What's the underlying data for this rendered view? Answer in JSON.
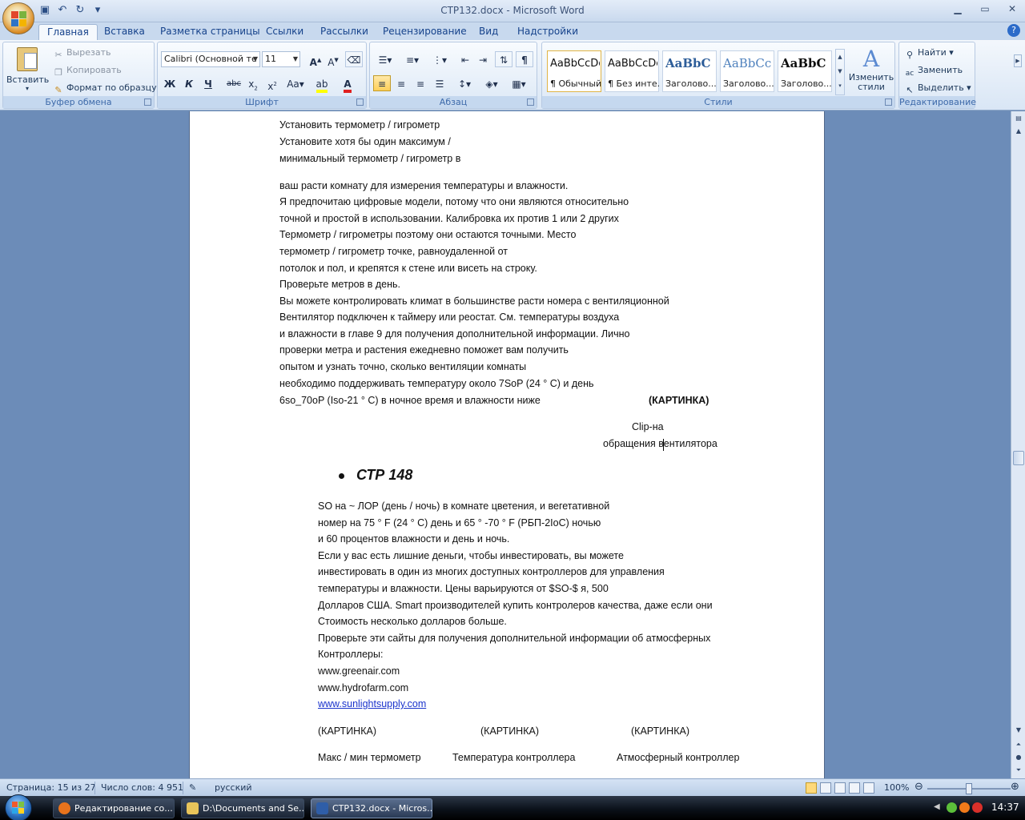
{
  "window": {
    "title": "СТР132.docx - Microsoft Word"
  },
  "tabs": [
    "Главная",
    "Вставка",
    "Разметка страницы",
    "Ссылки",
    "Рассылки",
    "Рецензирование",
    "Вид",
    "Надстройки"
  ],
  "ribbon": {
    "clipboard": {
      "label": "Буфер обмена",
      "paste": "Вставить",
      "cut": "Вырезать",
      "copy": "Копировать",
      "format_painter": "Формат по образцу"
    },
    "font": {
      "label": "Шрифт",
      "font_name": "Calibri (Основной те",
      "font_size": "11"
    },
    "paragraph": {
      "label": "Абзац"
    },
    "styles": {
      "label": "Стили",
      "items": [
        {
          "sample": "AaBbCcDc",
          "name": "¶ Обычный"
        },
        {
          "sample": "AaBbCcDc",
          "name": "¶ Без инте..."
        },
        {
          "sample": "AaBbC",
          "name": "Заголово..."
        },
        {
          "sample": "AaBbCc",
          "name": "Заголово..."
        },
        {
          "sample": "AaBbC",
          "name": "Заголово..."
        }
      ],
      "change_styles": "Изменить стили"
    },
    "editing": {
      "label": "Редактирование",
      "find": "Найти",
      "replace": "Заменить",
      "select": "Выделить"
    }
  },
  "document": {
    "lines_a": [
      "Установить термометр / гигрометр",
      "Установите хотя бы один максимум /",
      "минимальный термометр / гигрометр в"
    ],
    "lines_b": [
      "ваш расти комнату для измерения температуры и влажности.",
      "Я предпочитаю цифровые модели, потому что они являются относительно",
      "точной и простой в  использовании. Калибровка их против 1  или 2 других",
      "Термометр / гигрометры поэтому они остаются точными. Место",
      "термометр / гигрометр точке, равноудаленной от",
      "потолок и пол, и крепятся к стене или висеть на строку.",
      "Проверьте метров в день.",
      "Вы можете контролировать климат в большинстве расти номера с вентиляционной",
      "Вентилятор подключен к таймеру или реостат. См. температуры воздуха",
      "и влажности в главе 9  для получения дополнительной информации. Лично",
      "проверки метра и растения ежедневно поможет вам получить",
      "опытом и узнать точно, сколько вентиляции комнаты",
      "необходимо поддерживать температуру около 7SoP (24 ° C) и день",
      "6so_70oP (Iso-21 ° C) в ночное время и влажности ниже"
    ],
    "picture_label": "(КАРТИНКА)",
    "caption_1": "Clip-на",
    "caption_2": "обращения вентилятора",
    "heading": "СТР 148",
    "lines_c": [
      "SO на ~ ЛОР (день / ночь) в  комнате цветения, и вегетативной",
      "номер на 75  ° F (24 ° C) день и 65  ° -70  ° F (РБП-2IoC) ночью",
      "и 60  процентов влажности и день и ночь.",
      "Если у вас есть лишние деньги, чтобы инвестировать, вы можете",
      "инвестировать в один из многих доступных контроллеров для управления",
      "температуры и влажности. Цены варьируются от $SO-$ я, 500",
      "Долларов США. Smart производителей купить контролеров качества, даже если они",
      "Стоимость несколько долларов больше.",
      "Проверьте эти сайты для получения дополнительной информации об атмосферных",
      "Контроллеры:",
      "www.greenair.com",
      "www.hydrofarm.com"
    ],
    "link": "www.sunlightsupply.com",
    "pictures": [
      "(КАРТИНКА)",
      "(КАРТИНКА)",
      "(КАРТИНКА)"
    ],
    "captions": [
      "Макс / мин термометр",
      "Температура контроллера",
      "Атмосферный контроллер"
    ]
  },
  "statusbar": {
    "page": "Страница: 15 из 27",
    "words": "Число слов: 4 951",
    "language": "русский",
    "zoom": "100%",
    "zoom_level_percent": 100
  },
  "taskbar": {
    "items": [
      {
        "label": "Редактирование со...",
        "color": "#e8731c"
      },
      {
        "label": "D:\\Documents and Se...",
        "color": "#e8c45a"
      },
      {
        "label": "СТР132.docx - Micros...",
        "color": "#2f5ea8"
      }
    ],
    "clock": "14:37"
  }
}
